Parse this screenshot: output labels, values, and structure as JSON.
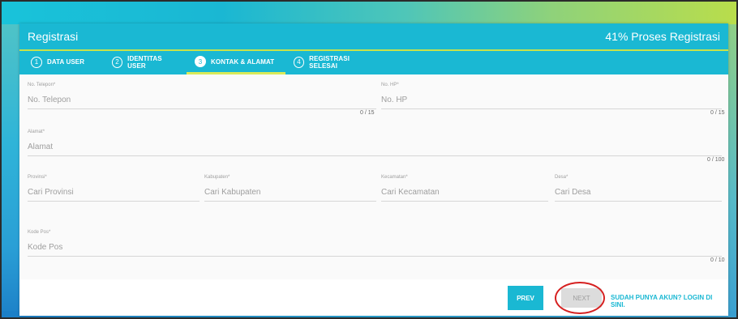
{
  "header": {
    "title": "Registrasi",
    "progress": "41% Proses Registrasi"
  },
  "tabs": [
    {
      "num": "1",
      "label": "DATA USER"
    },
    {
      "num": "2",
      "label": "IDENTITAS USER"
    },
    {
      "num": "3",
      "label": "KONTAK & ALAMAT"
    },
    {
      "num": "4",
      "label": "REGISTRASI SELESAI"
    }
  ],
  "form": {
    "telepon": {
      "label": "No. Telepon",
      "req": "*",
      "placeholder": "No. Telepon",
      "counter": "0 / 15"
    },
    "hp": {
      "label": "No. HP",
      "req": "*",
      "placeholder": "No. HP",
      "counter": "0 / 15"
    },
    "alamat": {
      "label": "Alamat",
      "req": "*",
      "placeholder": "Alamat",
      "counter": "0 / 100"
    },
    "provinsi": {
      "label": "Provinsi",
      "req": "*",
      "placeholder": "Cari Provinsi"
    },
    "kabupaten": {
      "label": "Kabupaten",
      "req": "*",
      "placeholder": "Cari Kabupaten"
    },
    "kecamatan": {
      "label": "Kecamatan",
      "req": "*",
      "placeholder": "Cari Kecamatan"
    },
    "desa": {
      "label": "Desa",
      "req": "*",
      "placeholder": "Cari Desa"
    },
    "kodepos": {
      "label": "Kode Pos",
      "req": "*",
      "placeholder": "Kode Pos",
      "counter": "0 / 10"
    }
  },
  "footer": {
    "prev_label": "PREV",
    "next_label": "NEXT",
    "login_link": "SUDAH PUNYA AKUN? LOGIN DI SINI."
  },
  "colors": {
    "primary": "#1ab8d3",
    "accent": "#d9ea58",
    "annotation": "#d62020"
  }
}
